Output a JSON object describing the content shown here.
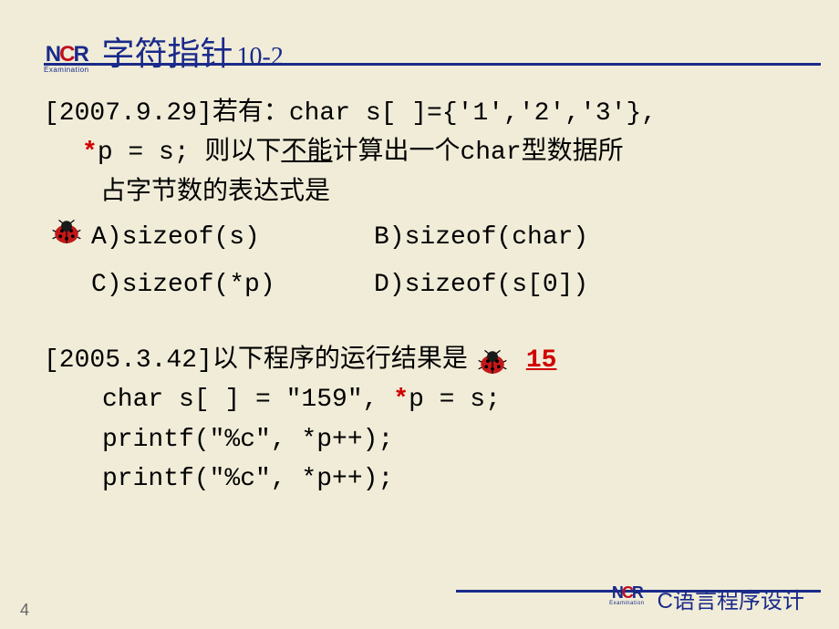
{
  "logo": {
    "text_n": "N",
    "text_c": "C",
    "text_r": "R",
    "sub": "Examination"
  },
  "title": {
    "main": "字符指针",
    "sub": "10-2"
  },
  "q1": {
    "prefix": "[2007.9.29]若有：char s[ ]={'1','2','3'},",
    "line2_a": "*",
    "line2_b": "p = s; 则以下",
    "line2_u": "不能",
    "line2_c": "计算出一个char型数据所",
    "line3": "占字节数的表达式是",
    "opts": {
      "a": "A)sizeof(s)",
      "b": "B)sizeof(char)",
      "c": "C)sizeof(*p)",
      "d": "D)sizeof(s[0])"
    }
  },
  "q2": {
    "prefix": "[2005.3.42]以下程序的运行结果是",
    "answer": "15",
    "code1_a": "char s[ ] = \"159\", ",
    "code1_star": "*",
    "code1_b": "p = s;",
    "code2": "printf(\"%c\", *p++);",
    "code3": "printf(\"%c\", *p++);"
  },
  "footer": {
    "page": "4",
    "course": "C语言程序设计"
  }
}
